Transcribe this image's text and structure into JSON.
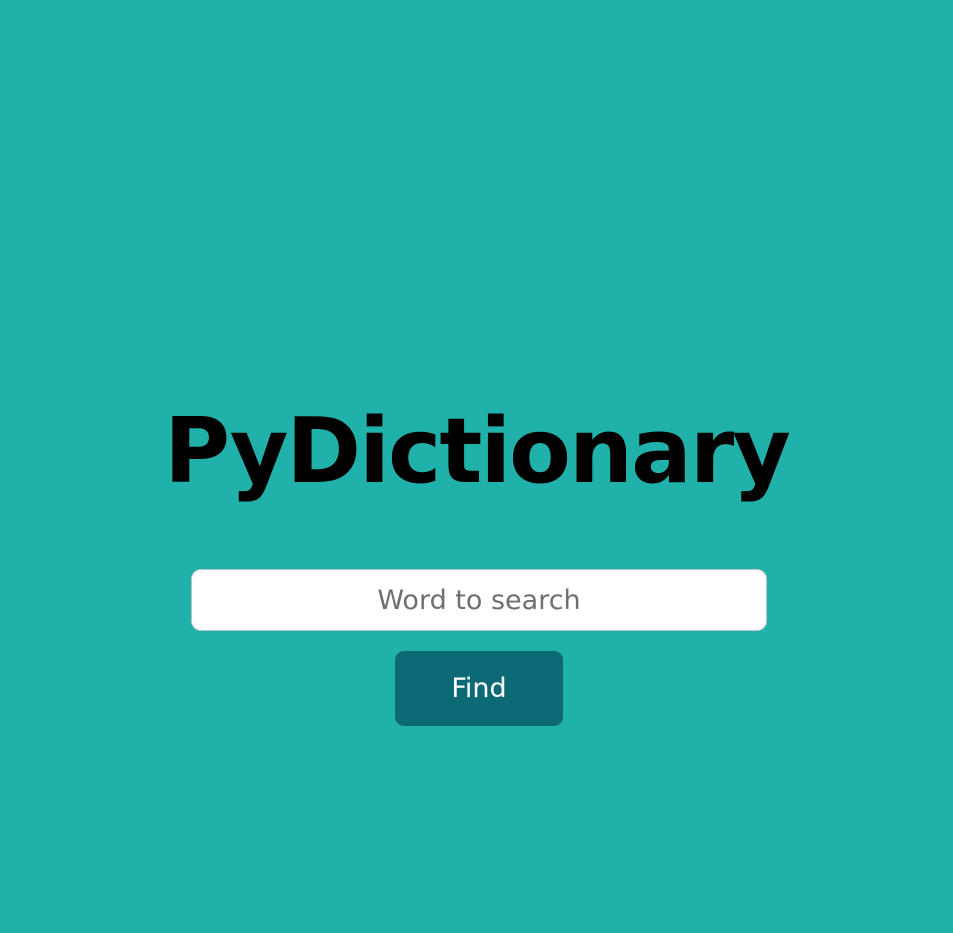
{
  "app": {
    "title": "PyDictionary"
  },
  "search": {
    "placeholder": "Word to search",
    "value": ""
  },
  "actions": {
    "find_label": "Find"
  },
  "colors": {
    "background": "#20b2aa",
    "button": "#0b6a75",
    "title_text": "#000000",
    "input_background": "#ffffff",
    "button_text": "#ffffff"
  }
}
